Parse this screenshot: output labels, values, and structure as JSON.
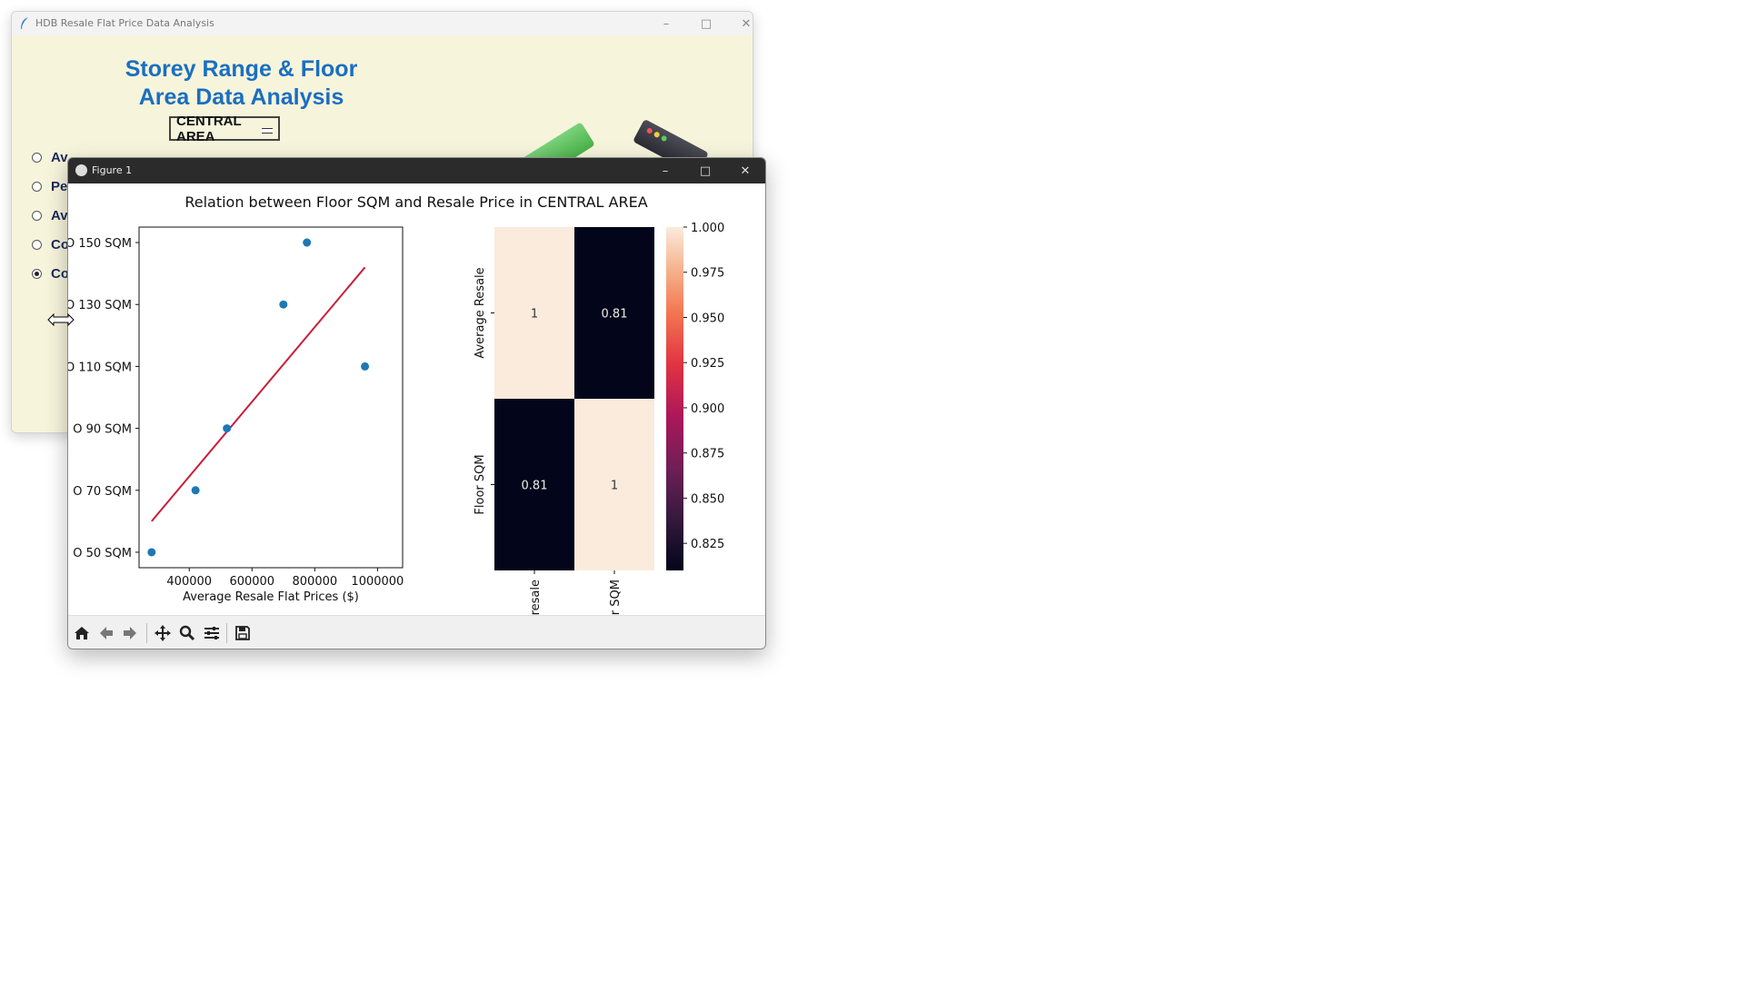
{
  "main_window": {
    "title": "HDB Resale Flat Price Data Analysis",
    "heading_line1": "Storey Range & Floor",
    "heading_line2": "Area Data Analysis",
    "town_dropdown": "CENTRAL AREA",
    "radio_options": [
      {
        "label": "Av",
        "selected": false
      },
      {
        "label": "Pe",
        "selected": false
      },
      {
        "label": "Av",
        "selected": false
      },
      {
        "label": "Co",
        "selected": false
      },
      {
        "label": "Co",
        "selected": true
      }
    ]
  },
  "figure_window": {
    "title": "Figure 1"
  },
  "colors": {
    "heading": "#1a6fc0",
    "scatter_point": "#1f77b4",
    "regression_line": "#c81e3a",
    "main_bg": "#f7f4dc"
  },
  "chart_data": [
    {
      "type": "scatter",
      "title": "Relation between Floor SQM and Resale Price in CENTRAL AREA",
      "xlabel": "Average Resale Flat Prices ($)",
      "ylabel": "",
      "x_ticks": [
        "400000",
        "600000",
        "800000",
        "1000000"
      ],
      "x_tick_values": [
        400000,
        600000,
        800000,
        1000000
      ],
      "y_ticks": [
        "O 50 SQM",
        "O 70 SQM",
        "O 90 SQM",
        "O 110 SQM",
        "O 130 SQM",
        "O 150 SQM"
      ],
      "y_tick_values": [
        50,
        70,
        90,
        110,
        130,
        150
      ],
      "xlim": [
        240000,
        1080000
      ],
      "ylim": [
        45,
        155
      ],
      "points": [
        {
          "x": 280000,
          "y": 50
        },
        {
          "x": 420000,
          "y": 70
        },
        {
          "x": 520000,
          "y": 90
        },
        {
          "x": 700000,
          "y": 130
        },
        {
          "x": 775000,
          "y": 150
        },
        {
          "x": 960000,
          "y": 110
        }
      ],
      "regression_line": [
        {
          "x": 280000,
          "y": 60
        },
        {
          "x": 960000,
          "y": 142
        }
      ],
      "grid": false
    },
    {
      "type": "heatmap",
      "row_labels": [
        "Average Resale",
        "Floor SQM"
      ],
      "col_labels": [
        "resale",
        "r SQM"
      ],
      "values": [
        [
          1,
          0.81
        ],
        [
          0.81,
          1
        ]
      ],
      "annotations": [
        [
          "1",
          "0.81"
        ],
        [
          "0.81",
          "1"
        ]
      ],
      "colorbar_ticks": [
        "1.000",
        "0.975",
        "0.950",
        "0.925",
        "0.900",
        "0.875",
        "0.850",
        "0.825"
      ],
      "colorbar_tick_values": [
        1.0,
        0.975,
        0.95,
        0.925,
        0.9,
        0.875,
        0.85,
        0.825
      ],
      "vmin": 0.81,
      "vmax": 1.0,
      "colormap": "rocket"
    }
  ]
}
